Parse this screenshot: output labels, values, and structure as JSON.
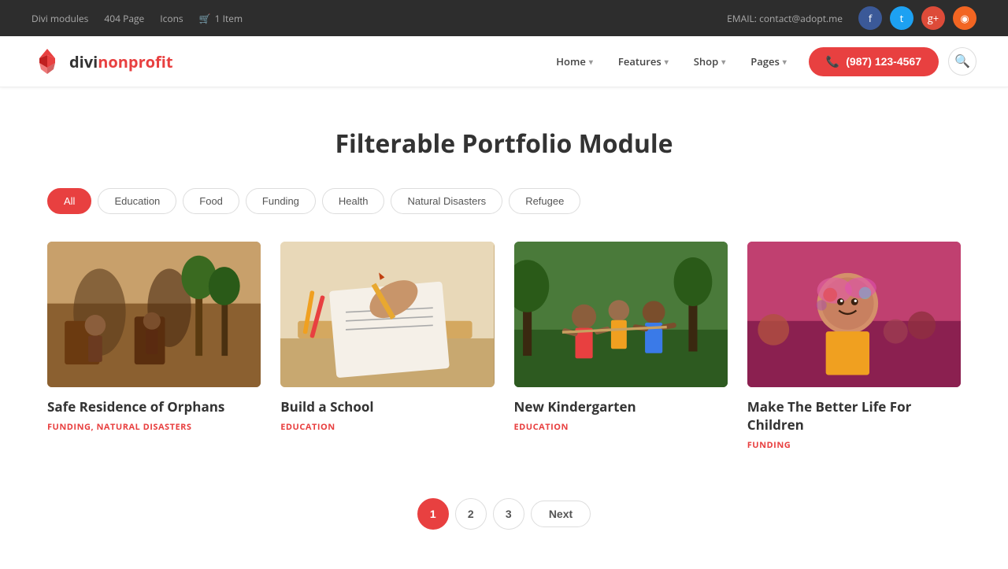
{
  "topbar": {
    "links": [
      {
        "label": "Divi modules",
        "href": "#"
      },
      {
        "label": "404 Page",
        "href": "#"
      },
      {
        "label": "Icons",
        "href": "#"
      }
    ],
    "cart": {
      "icon": "🛒",
      "label": "1 Item"
    },
    "email_prefix": "EMAIL:",
    "email": "contact@adopt.me",
    "social_icons": [
      {
        "name": "facebook-icon",
        "symbol": "f",
        "class": "social-fb"
      },
      {
        "name": "twitter-icon",
        "symbol": "t",
        "class": "social-tw"
      },
      {
        "name": "googleplus-icon",
        "symbol": "g+",
        "class": "social-gp"
      },
      {
        "name": "rss-icon",
        "symbol": "◉",
        "class": "social-rss"
      }
    ]
  },
  "navbar": {
    "logo_text_1": "divi",
    "logo_text_2": "nonprofit",
    "nav_items": [
      {
        "label": "Home",
        "has_dropdown": true
      },
      {
        "label": "Features",
        "has_dropdown": true
      },
      {
        "label": "Shop",
        "has_dropdown": true
      },
      {
        "label": "Pages",
        "has_dropdown": true
      }
    ],
    "phone": "(987) 123-4567",
    "search_icon": "🔍"
  },
  "page": {
    "title": "Filterable Portfolio Module"
  },
  "filters": {
    "tabs": [
      {
        "label": "All",
        "active": true
      },
      {
        "label": "Education",
        "active": false
      },
      {
        "label": "Food",
        "active": false
      },
      {
        "label": "Funding",
        "active": false
      },
      {
        "label": "Health",
        "active": false
      },
      {
        "label": "Natural Disasters",
        "active": false
      },
      {
        "label": "Refugee",
        "active": false
      }
    ]
  },
  "portfolio": {
    "items": [
      {
        "title": "Safe Residence of Orphans",
        "categories": "FUNDING, NATURAL DISASTERS",
        "img_class": "card-img-1"
      },
      {
        "title": "Build a School",
        "categories": "EDUCATION",
        "img_class": "card-img-2"
      },
      {
        "title": "New Kindergarten",
        "categories": "EDUCATION",
        "img_class": "card-img-3"
      },
      {
        "title": "Make The Better Life For Children",
        "categories": "FUNDING",
        "img_class": "card-img-4"
      }
    ]
  },
  "pagination": {
    "pages": [
      "1",
      "2",
      "3"
    ],
    "active_page": "1",
    "next_label": "Next"
  }
}
